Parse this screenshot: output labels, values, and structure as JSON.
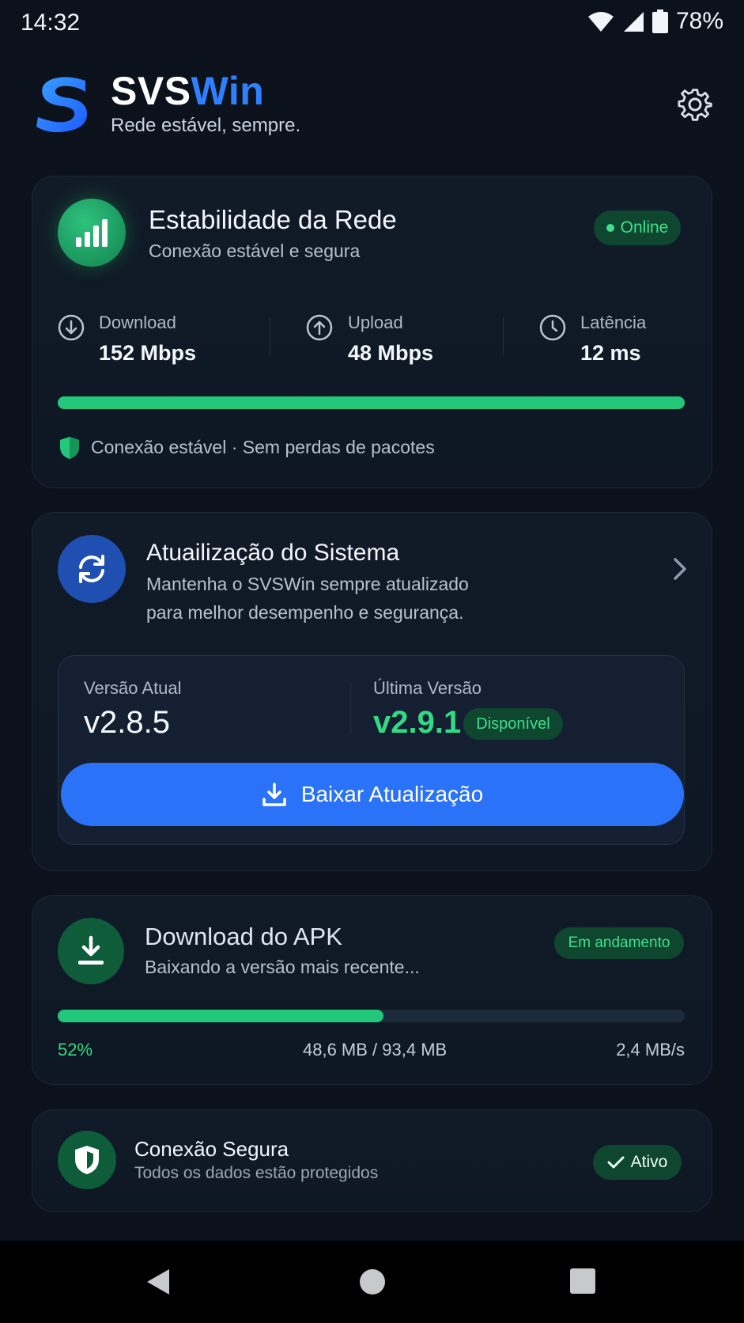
{
  "status_bar": {
    "time": "14:32",
    "battery": "78%"
  },
  "header": {
    "brand_part1": "SVS",
    "brand_part2": "Win",
    "tagline": "Rede estável, sempre.",
    "brand_color": "#2f80ff"
  },
  "network_card": {
    "title": "Estabilidade da Rede",
    "subtitle": "Conexão estável e segura",
    "status": "Online",
    "stats": [
      {
        "label": "Download",
        "value": "152 Mbps"
      },
      {
        "label": "Upload",
        "value": "48 Mbps"
      },
      {
        "label": "Latência",
        "value": "12 ms"
      }
    ],
    "stability_fraction": 1.0,
    "footer": "Conexão estável · Sem perdas de pacotes"
  },
  "update_card": {
    "title": "Atuailização do Sistema",
    "subtitle_line1": "Mantenha o SVSWin sempre atualizado",
    "subtitle_line2": "para melhor desempenho e segurança.",
    "current_label": "Versão Atual",
    "current_version": "v2.8.5",
    "latest_label": "Última Versão",
    "latest_version": "v2.9.1",
    "latest_badge": "Disponível",
    "button_label": "Baixar Atualização"
  },
  "apk_card": {
    "title": "Download do APK",
    "subtitle": "Baixando a versão mais recente...",
    "status": "Em andamento",
    "progress_fraction": 0.52,
    "percent_text": "52%",
    "size_text": "48,6 MB / 93,4 MB",
    "speed_text": "2,4 MB/s"
  },
  "secure_card": {
    "title": "Conexão Segura",
    "subtitle": "Todos os dados estão protegidos",
    "status": "Ativo"
  },
  "colors": {
    "accent_green": "#22c77a",
    "accent_blue": "#2a72f8",
    "background": "#0b121c"
  },
  "icons": [
    "wifi-icon",
    "signal-icon",
    "battery-icon",
    "gear-icon",
    "signal-bars-icon",
    "download-circle-icon",
    "upload-circle-icon",
    "clock-icon",
    "shield-icon",
    "refresh-icon",
    "chevron-right-icon",
    "download-icon",
    "check-icon",
    "back-icon",
    "home-icon",
    "recents-icon"
  ]
}
